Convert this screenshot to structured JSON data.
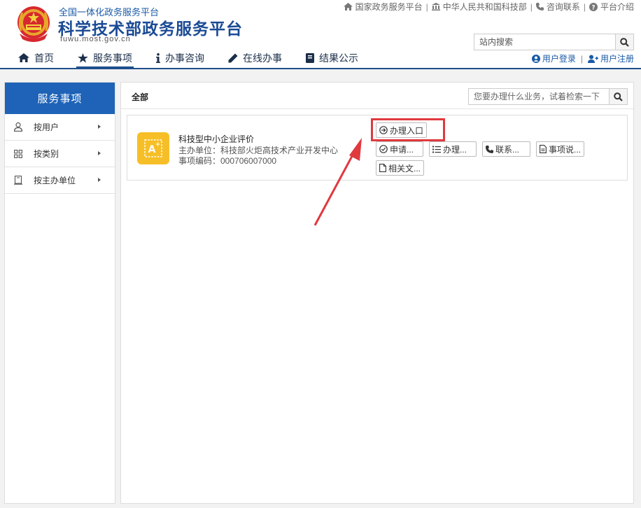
{
  "header": {
    "subtitle": "全国一体化政务服务平台",
    "title": "科学技术部政务服务平台",
    "url": "fuwu.most.gov.cn"
  },
  "top_links": [
    {
      "label": "国家政务服务平台",
      "icon": "home-icon"
    },
    {
      "label": "中华人民共和国科技部",
      "icon": "bank-icon"
    },
    {
      "label": "咨询联系",
      "icon": "phone-icon"
    },
    {
      "label": "平台介绍",
      "icon": "question-circle-icon"
    }
  ],
  "site_search": {
    "placeholder": "站内搜索"
  },
  "user_links": {
    "login": "用户登录",
    "register": "用户注册"
  },
  "nav": [
    {
      "label": "首页",
      "icon": "home-icon"
    },
    {
      "label": "服务事项",
      "icon": "star-icon",
      "active": true
    },
    {
      "label": "办事咨询",
      "icon": "info-icon"
    },
    {
      "label": "在线办事",
      "icon": "pencil-icon"
    },
    {
      "label": "结果公示",
      "icon": "book-icon"
    }
  ],
  "sidebar": {
    "title": "服务事项",
    "items": [
      {
        "label": "按用户",
        "icon": "user-icon"
      },
      {
        "label": "按类别",
        "icon": "grid-icon"
      },
      {
        "label": "按主办单位",
        "icon": "building-icon"
      }
    ]
  },
  "main": {
    "breadcrumb": "全部",
    "search_placeholder": "您要办理什么业务，试着检索一下"
  },
  "service": {
    "title": "科技型中小企业评价",
    "unit": "主办单位：科技部火炬高技术产业开发中心",
    "code": "事项编码：000706007000",
    "buttons": {
      "entry": "办理入口",
      "apply": "申请...",
      "process": "办理...",
      "contact": "联系...",
      "guide": "事项说...",
      "docs": "相关文..."
    }
  },
  "colors": {
    "brand": "#1e4f8c",
    "sidebar_head": "#1e63b7",
    "highlight": "#e0393e",
    "icon_bg": "#f7bf27"
  }
}
